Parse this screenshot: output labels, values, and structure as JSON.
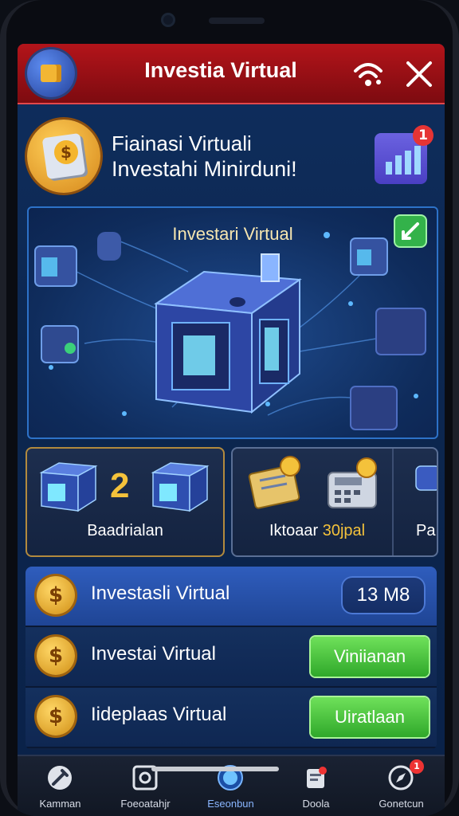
{
  "header": {
    "title": "Investia Virtual"
  },
  "intro": {
    "line1": "Fiainasi Virtuali",
    "line2": "Investahi Minirduni!",
    "notification_count": "1"
  },
  "hero": {
    "title": "Investari Virtual"
  },
  "stats": {
    "card1_number": "2",
    "card1_label": "Baadrialan",
    "card2_label_prefix": "Iktoaar ",
    "card2_label_value": "30jpal",
    "card3_partial": "Pa"
  },
  "list": {
    "items": [
      {
        "label": "Investasli Virtual",
        "value": "13 M8",
        "coin": "$"
      },
      {
        "label": "Investai Virtual",
        "action": "Viniianan",
        "coin": "$"
      },
      {
        "label": "Iideplaas Virtual",
        "action": "Uiratlaan",
        "coin": "$"
      }
    ]
  },
  "nav": {
    "items": [
      {
        "label": "Kamman",
        "icon": "tools-icon"
      },
      {
        "label": "Foeoatahjr",
        "icon": "square-icon"
      },
      {
        "label": "Eseonbun",
        "icon": "globe-icon"
      },
      {
        "label": "Doola",
        "icon": "document-icon",
        "badge": ""
      },
      {
        "label": "Gonetcun",
        "icon": "compass-icon",
        "badge": "1"
      }
    ]
  },
  "colors": {
    "titlebar": "#b3141a",
    "accent_gold": "#f4c23b",
    "button_green": "#2fa82a",
    "panel_blue": "#0f2e5e"
  }
}
